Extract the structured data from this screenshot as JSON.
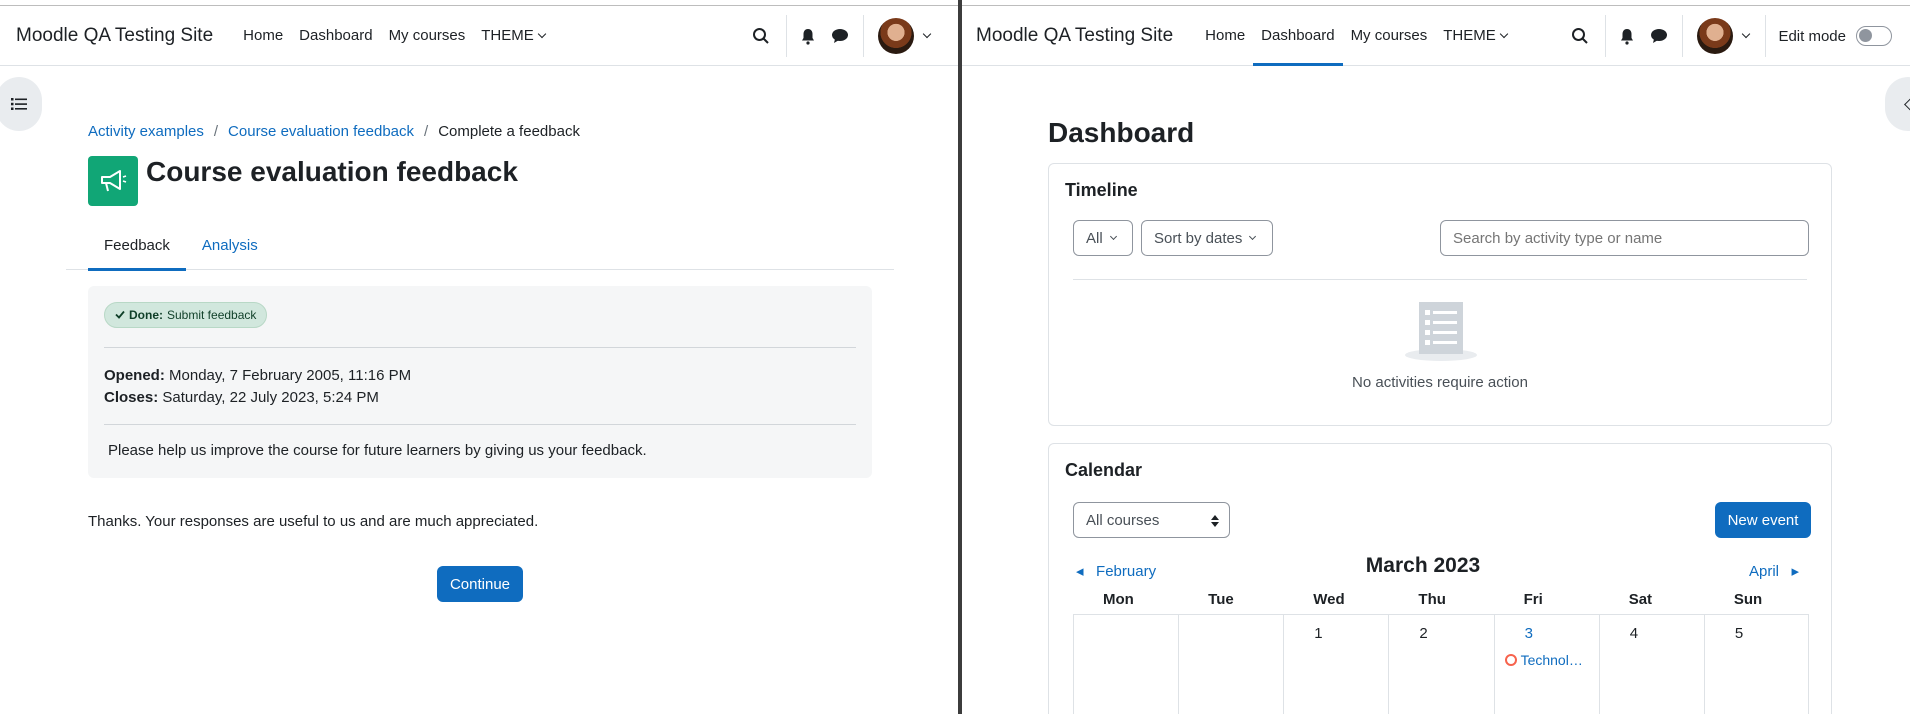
{
  "left": {
    "site_name": "Moodle QA Testing Site",
    "nav": [
      {
        "label": "Home"
      },
      {
        "label": "Dashboard"
      },
      {
        "label": "My courses"
      },
      {
        "label": "THEME"
      }
    ],
    "breadcrumb": [
      {
        "label": "Activity examples",
        "link": true
      },
      {
        "label": "Course evaluation feedback",
        "link": true
      },
      {
        "label": "Complete a feedback",
        "link": false
      }
    ],
    "page_title": "Course evaluation feedback",
    "tabs": [
      {
        "label": "Feedback",
        "active": true
      },
      {
        "label": "Analysis",
        "active": false
      }
    ],
    "badge": {
      "strong": "Done:",
      "text": "Submit feedback"
    },
    "opened_label": "Opened:",
    "opened_value": "Monday, 7 February 2005, 11:16 PM",
    "closes_label": "Closes:",
    "closes_value": "Saturday, 22 July 2023, 5:24 PM",
    "intro": "Please help us improve the course for future learners by giving us your feedback.",
    "thanks": "Thanks. Your responses are useful to us and are much appreciated.",
    "continue_label": "Continue"
  },
  "right": {
    "site_name": "Moodle QA Testing Site",
    "nav": [
      {
        "label": "Home",
        "active": false
      },
      {
        "label": "Dashboard",
        "active": true
      },
      {
        "label": "My courses",
        "active": false
      },
      {
        "label": "THEME",
        "active": false
      }
    ],
    "edit_mode_label": "Edit mode",
    "page_title": "Dashboard",
    "timeline": {
      "title": "Timeline",
      "filter_label": "All",
      "sort_label": "Sort by dates",
      "search_placeholder": "Search by activity type or name",
      "empty_text": "No activities require action"
    },
    "calendar": {
      "title": "Calendar",
      "course_select": "All courses",
      "new_event_label": "New event",
      "prev_month": "February",
      "month_title": "March 2023",
      "next_month": "April",
      "weekdays": [
        "Mon",
        "Tue",
        "Wed",
        "Thu",
        "Fri",
        "Sat",
        "Sun"
      ],
      "week1": [
        "",
        "",
        "1",
        "2",
        "3",
        "4",
        "5"
      ],
      "event_day_index": 4,
      "event_label": "Technol…"
    }
  },
  "colors": {
    "accent": "#0f6cbf",
    "activity_icon": "#11a676",
    "badge_bg": "#d1e7dd",
    "event_dot": "#f7634d"
  }
}
